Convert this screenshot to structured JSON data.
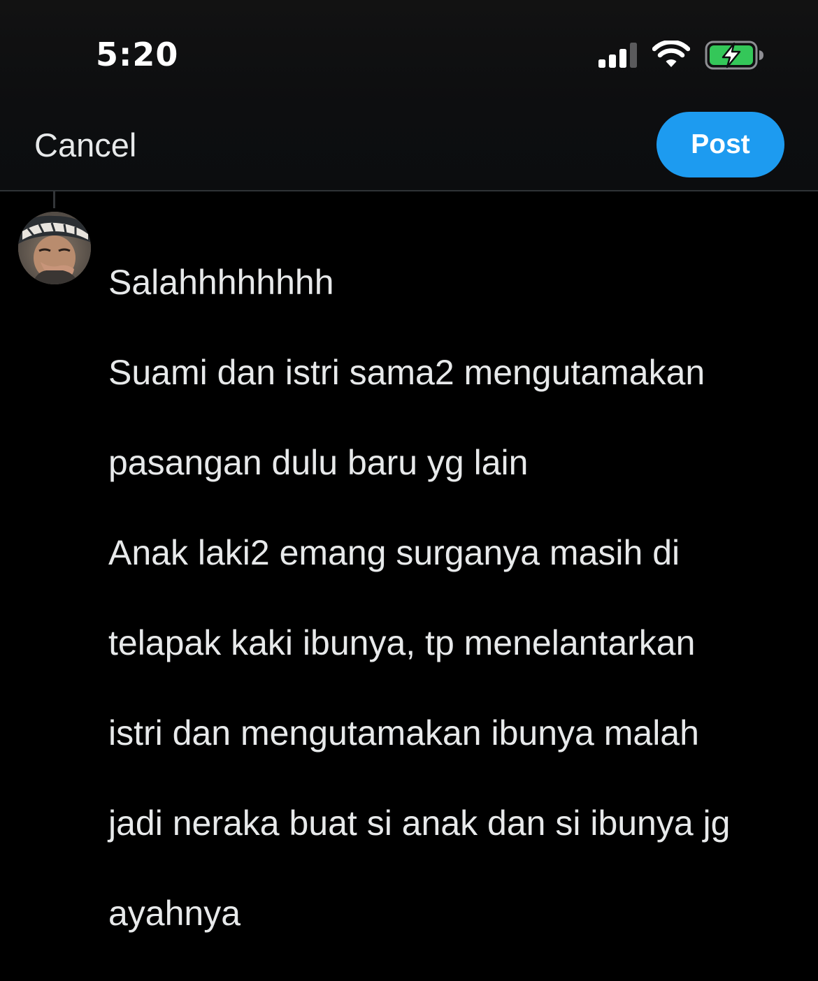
{
  "status_bar": {
    "time": "5:20",
    "signal_icon": "cellular-signal-icon",
    "wifi_icon": "wifi-icon",
    "battery_icon": "battery-charging-icon",
    "battery_color": "#34c759"
  },
  "nav": {
    "cancel_label": "Cancel",
    "post_label": "Post",
    "post_color": "#1d9bf0"
  },
  "reply": {
    "avatar_icon": "user-avatar",
    "lines": [
      "Salahhhhhhhh",
      "Suami dan istri sama2 mengutamakan",
      "pasangan dulu baru yg lain",
      "Anak laki2 emang surganya masih di",
      "telapak kaki ibunya, tp menelantarkan",
      "istri dan mengutamakan ibunya malah",
      "jadi neraka buat si anak dan si ibunya jg",
      "ayahnya"
    ]
  }
}
